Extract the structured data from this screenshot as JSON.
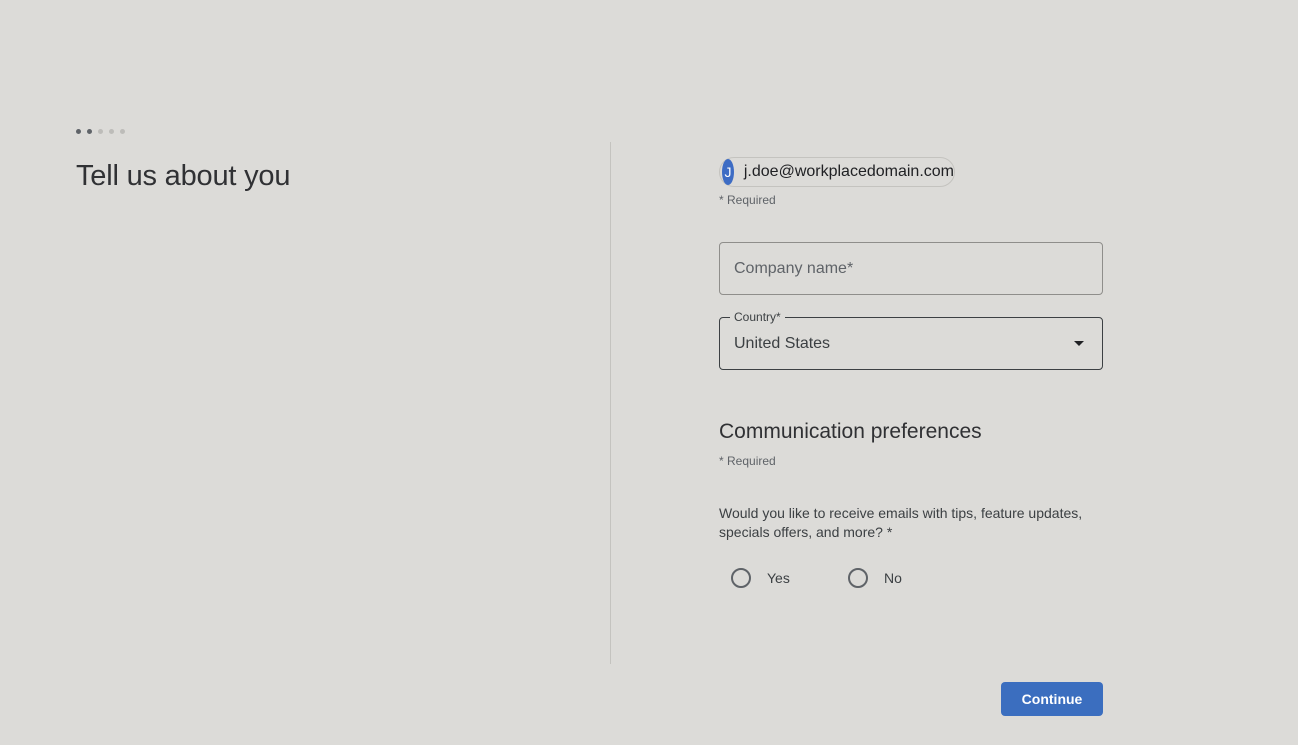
{
  "progress": {
    "total_steps": 5,
    "completed_steps": 2
  },
  "page": {
    "title": "Tell us about you"
  },
  "account": {
    "initial": "J",
    "email": "j.doe@workplacedomain.com",
    "avatar_color": "#3d6cc4"
  },
  "form": {
    "required_note": "* Required",
    "company_name": {
      "placeholder": "Company name*",
      "value": ""
    },
    "country": {
      "label": "Country*",
      "value": "United States"
    }
  },
  "communication": {
    "title": "Communication preferences",
    "required_note": "* Required",
    "question": "Would you like to receive emails with tips, feature updates, specials offers, and more? *",
    "options": {
      "yes": "Yes",
      "no": "No"
    }
  },
  "actions": {
    "continue_label": "Continue",
    "accent_color": "#3b6ebf"
  }
}
